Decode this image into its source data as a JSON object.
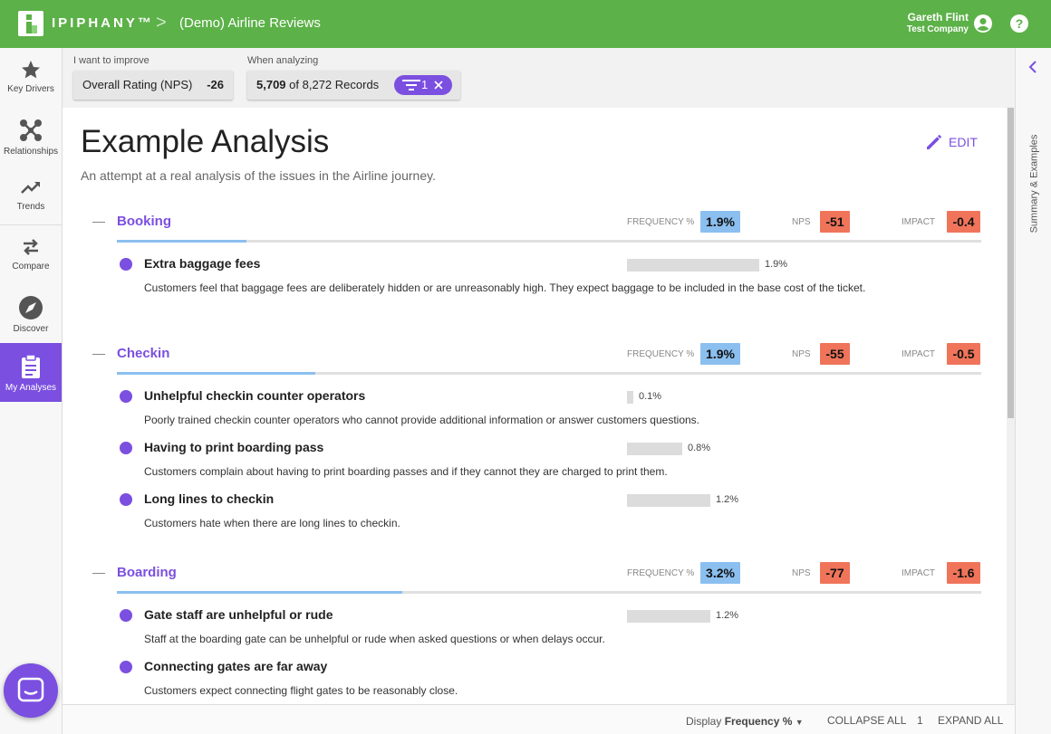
{
  "header": {
    "brand": "IPIPHANY™",
    "breadcrumb_sep": ">",
    "breadcrumb": "(Demo) Airline Reviews",
    "user_name": "Gareth Flint",
    "user_company": "Test Company",
    "accent_color": "#5cb148"
  },
  "sidebar": {
    "items": [
      {
        "label": "Key Drivers",
        "icon": "star-icon"
      },
      {
        "label": "Relationships",
        "icon": "network-icon"
      },
      {
        "label": "Trends",
        "icon": "trend-icon"
      },
      {
        "label": "Compare",
        "icon": "swap-icon"
      },
      {
        "label": "Discover",
        "icon": "compass-icon"
      },
      {
        "label": "My Analyses",
        "icon": "clipboard-icon",
        "active": true
      }
    ]
  },
  "filters": {
    "improve_label": "I want to improve",
    "improve_metric": "Overall Rating (NPS)",
    "improve_value": "-26",
    "analyze_label": "When analyzing",
    "records_count": "5,709",
    "records_total": "of 8,272 Records",
    "filter_count": "1"
  },
  "right_rail": {
    "label": "Summary & Examples"
  },
  "analysis": {
    "title": "Example Analysis",
    "subtitle": "An attempt at a real analysis of the issues in the Airline journey.",
    "edit_label": "EDIT",
    "metric_labels": {
      "frequency": "FREQUENCY %",
      "nps": "NPS",
      "impact": "IMPACT"
    },
    "sections": [
      {
        "title": "Booking",
        "frequency": "1.9%",
        "nps": "-51",
        "impact": "-0.4",
        "progress": 0.15,
        "items": [
          {
            "title": "Extra baggage fees",
            "value": "1.9%",
            "bar_fraction": 1.0,
            "desc": "Customers feel that baggage fees are deliberately hidden or are unreasonably high. They expect baggage to be included in the base cost of the ticket."
          }
        ]
      },
      {
        "title": "Checkin",
        "frequency": "1.9%",
        "nps": "-55",
        "impact": "-0.5",
        "progress": 0.23,
        "items": [
          {
            "title": "Unhelpful checkin counter operators",
            "value": "0.1%",
            "bar_fraction": 0.05,
            "desc": "Poorly trained checkin counter operators who cannot provide additional information or answer customers questions."
          },
          {
            "title": "Having to print boarding pass",
            "value": "0.8%",
            "bar_fraction": 0.42,
            "desc": "Customers complain about having to print boarding passes and if they cannot they are charged to print them."
          },
          {
            "title": "Long lines to checkin",
            "value": "1.2%",
            "bar_fraction": 0.63,
            "desc": "Customers hate when there are long lines to checkin."
          }
        ]
      },
      {
        "title": "Boarding",
        "frequency": "3.2%",
        "nps": "-77",
        "impact": "-1.6",
        "progress": 0.33,
        "items": [
          {
            "title": "Gate staff are unhelpful or rude",
            "value": "1.2%",
            "bar_fraction": 0.63,
            "desc": "Staff at the boarding gate can be unhelpful or rude when asked questions or when delays occur."
          },
          {
            "title": "Connecting gates are far away",
            "value": "",
            "bar_fraction": 0,
            "desc": "Customers expect connecting flight gates to be reasonably close."
          }
        ]
      }
    ]
  },
  "footer": {
    "display_prefix": "Display",
    "display_value": "Frequency %",
    "collapse_all": "COLLAPSE ALL",
    "level": "1",
    "expand_all": "EXPAND ALL"
  },
  "colors": {
    "accent": "#7b4fe0",
    "frequency_badge": "#8bbff0",
    "negative_badge": "#f0745a"
  }
}
